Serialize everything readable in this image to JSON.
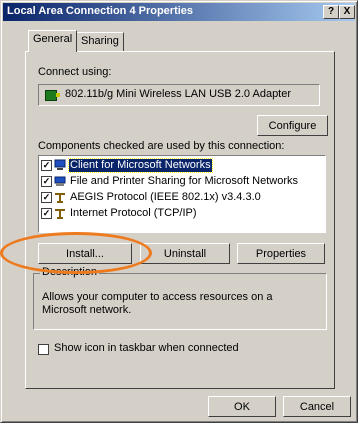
{
  "window": {
    "title": "Local Area Connection 4 Properties",
    "help_button": "?",
    "close_button": "X"
  },
  "tabs": [
    {
      "label": "General",
      "active": true
    },
    {
      "label": "Sharing",
      "active": false
    }
  ],
  "general": {
    "connect_using_label": "Connect using:",
    "adapter_icon": "network-adapter-icon",
    "adapter_name": "802.11b/g Mini Wireless LAN USB 2.0 Adapter",
    "configure_button": "Configure",
    "components_label": "Components checked are used by this connection:",
    "components": [
      {
        "label": "Client for Microsoft Networks",
        "checked": true,
        "icon": "client-network-icon",
        "selected": true
      },
      {
        "label": "File and Printer Sharing for Microsoft Networks",
        "checked": true,
        "icon": "file-printer-sharing-icon",
        "selected": false
      },
      {
        "label": "AEGIS Protocol (IEEE 802.1x) v3.4.3.0",
        "checked": true,
        "icon": "protocol-icon",
        "selected": false
      },
      {
        "label": "Internet Protocol (TCP/IP)",
        "checked": true,
        "icon": "protocol-icon",
        "selected": false
      }
    ],
    "install_button": "Install...",
    "uninstall_button": "Uninstall",
    "properties_button": "Properties",
    "description_title": "Description",
    "description_text": "Allows your computer to access resources on a Microsoft network.",
    "show_icon_label": "Show icon in taskbar when connected",
    "show_icon_checked": false
  },
  "footer": {
    "ok_button": "OK",
    "cancel_button": "Cancel"
  },
  "colors": {
    "dialog_bg": "#d4d0c8",
    "title_gradient_start": "#0a246a",
    "title_gradient_end": "#a6caf0",
    "selection": "#0a246a",
    "annotation_ellipse": "#ee7a1e"
  }
}
